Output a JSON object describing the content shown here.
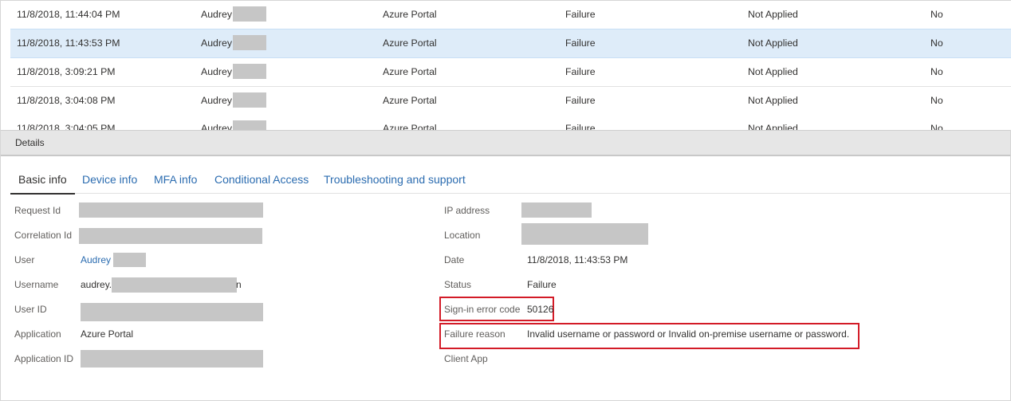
{
  "rows": [
    {
      "date": "11/8/2018, 11:44:04 PM",
      "user": "Audrey",
      "app": "Azure Portal",
      "status": "Failure",
      "ca": "Not Applied",
      "mfa": "No"
    },
    {
      "date": "11/8/2018, 11:43:53 PM",
      "user": "Audrey",
      "app": "Azure Portal",
      "status": "Failure",
      "ca": "Not Applied",
      "mfa": "No"
    },
    {
      "date": "11/8/2018, 3:09:21 PM",
      "user": "Audrey",
      "app": "Azure Portal",
      "status": "Failure",
      "ca": "Not Applied",
      "mfa": "No"
    },
    {
      "date": "11/8/2018, 3:04:08 PM",
      "user": "Audrey",
      "app": "Azure Portal",
      "status": "Failure",
      "ca": "Not Applied",
      "mfa": "No"
    },
    {
      "date": "11/8/2018, 3:04:05 PM",
      "user": "Audrey",
      "app": "Azure Portal",
      "status": "Failure",
      "ca": "Not Applied",
      "mfa": "No"
    }
  ],
  "details_label": "Details",
  "tabs": [
    "Basic info",
    "Device info",
    "MFA info",
    "Conditional Access",
    "Troubleshooting and support"
  ],
  "left": {
    "request_id_label": "Request Id",
    "correlation_id_label": "Correlation Id",
    "user_label": "User",
    "user_value": "Audrey",
    "username_label": "Username",
    "username_prefix": "audrey.",
    "username_suffix": "n",
    "user_id_label": "User ID",
    "application_label": "Application",
    "application_value": "Azure Portal",
    "application_id_label": "Application ID"
  },
  "right": {
    "ip_label": "IP address",
    "location_label": "Location",
    "date_label": "Date",
    "date_value": "11/8/2018, 11:43:53 PM",
    "status_label": "Status",
    "status_value": "Failure",
    "error_code_label": "Sign-in error code",
    "error_code_value": "50126",
    "failure_reason_label": "Failure reason",
    "failure_reason_value": "Invalid username or password or Invalid on-premise username or password.",
    "client_app_label": "Client App"
  },
  "colors": {
    "selected_row": "#deecf9",
    "link": "#2b6cb0",
    "highlight": "#d31b27",
    "redaction": "#c6c6c6"
  }
}
